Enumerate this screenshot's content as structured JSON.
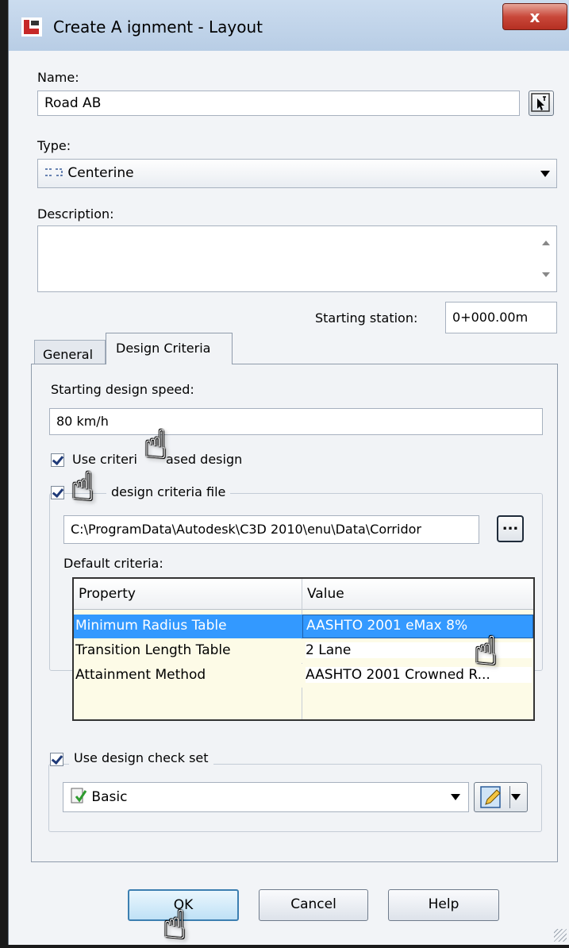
{
  "window": {
    "title": "Create A ignment - Layout",
    "close_label": "x"
  },
  "name_field": {
    "label": "Name:",
    "value": "Road AB"
  },
  "type_field": {
    "label": "Type:",
    "value": "Centerine",
    "icon": "alignment-centerline-icon"
  },
  "description_field": {
    "label": "Description:",
    "value": ""
  },
  "starting_station": {
    "label": "Starting station:",
    "value": "0+000.00m"
  },
  "tabs": [
    {
      "label": "General",
      "active": false
    },
    {
      "label": "Design Criteria",
      "active": true
    }
  ],
  "design_speed": {
    "label": "Starting design speed:",
    "value": "80 km/h"
  },
  "use_criteria_based_design": {
    "label": "Use criteri",
    "label_tail": "ased design",
    "checked": true
  },
  "use_criteria_file": {
    "label": "design criteria file",
    "checked": true
  },
  "criteria_file": {
    "path": "C:\\ProgramData\\Autodesk\\C3D 2010\\enu\\Data\\Corridor",
    "browse_label": "..."
  },
  "default_criteria": {
    "label": "Default criteria:",
    "columns": [
      "Property",
      "Value"
    ],
    "rows": [
      {
        "property": "Minimum Radius Table",
        "value": "AASHTO 2001 eMax 8%",
        "selected": true
      },
      {
        "property": "Transition Length Table",
        "value": "2 Lane",
        "selected": false
      },
      {
        "property": "Attainment Method",
        "value": "AASHTO 2001 Crowned R...",
        "selected": false
      }
    ]
  },
  "design_check_set": {
    "label": "Use design check set",
    "checked": true,
    "value": "Basic"
  },
  "buttons": {
    "ok": "OK",
    "cancel": "Cancel",
    "help": "Help"
  },
  "colors": {
    "selection": "#3399ff",
    "titlebar": "#b8cde5",
    "close": "#c9483a"
  }
}
